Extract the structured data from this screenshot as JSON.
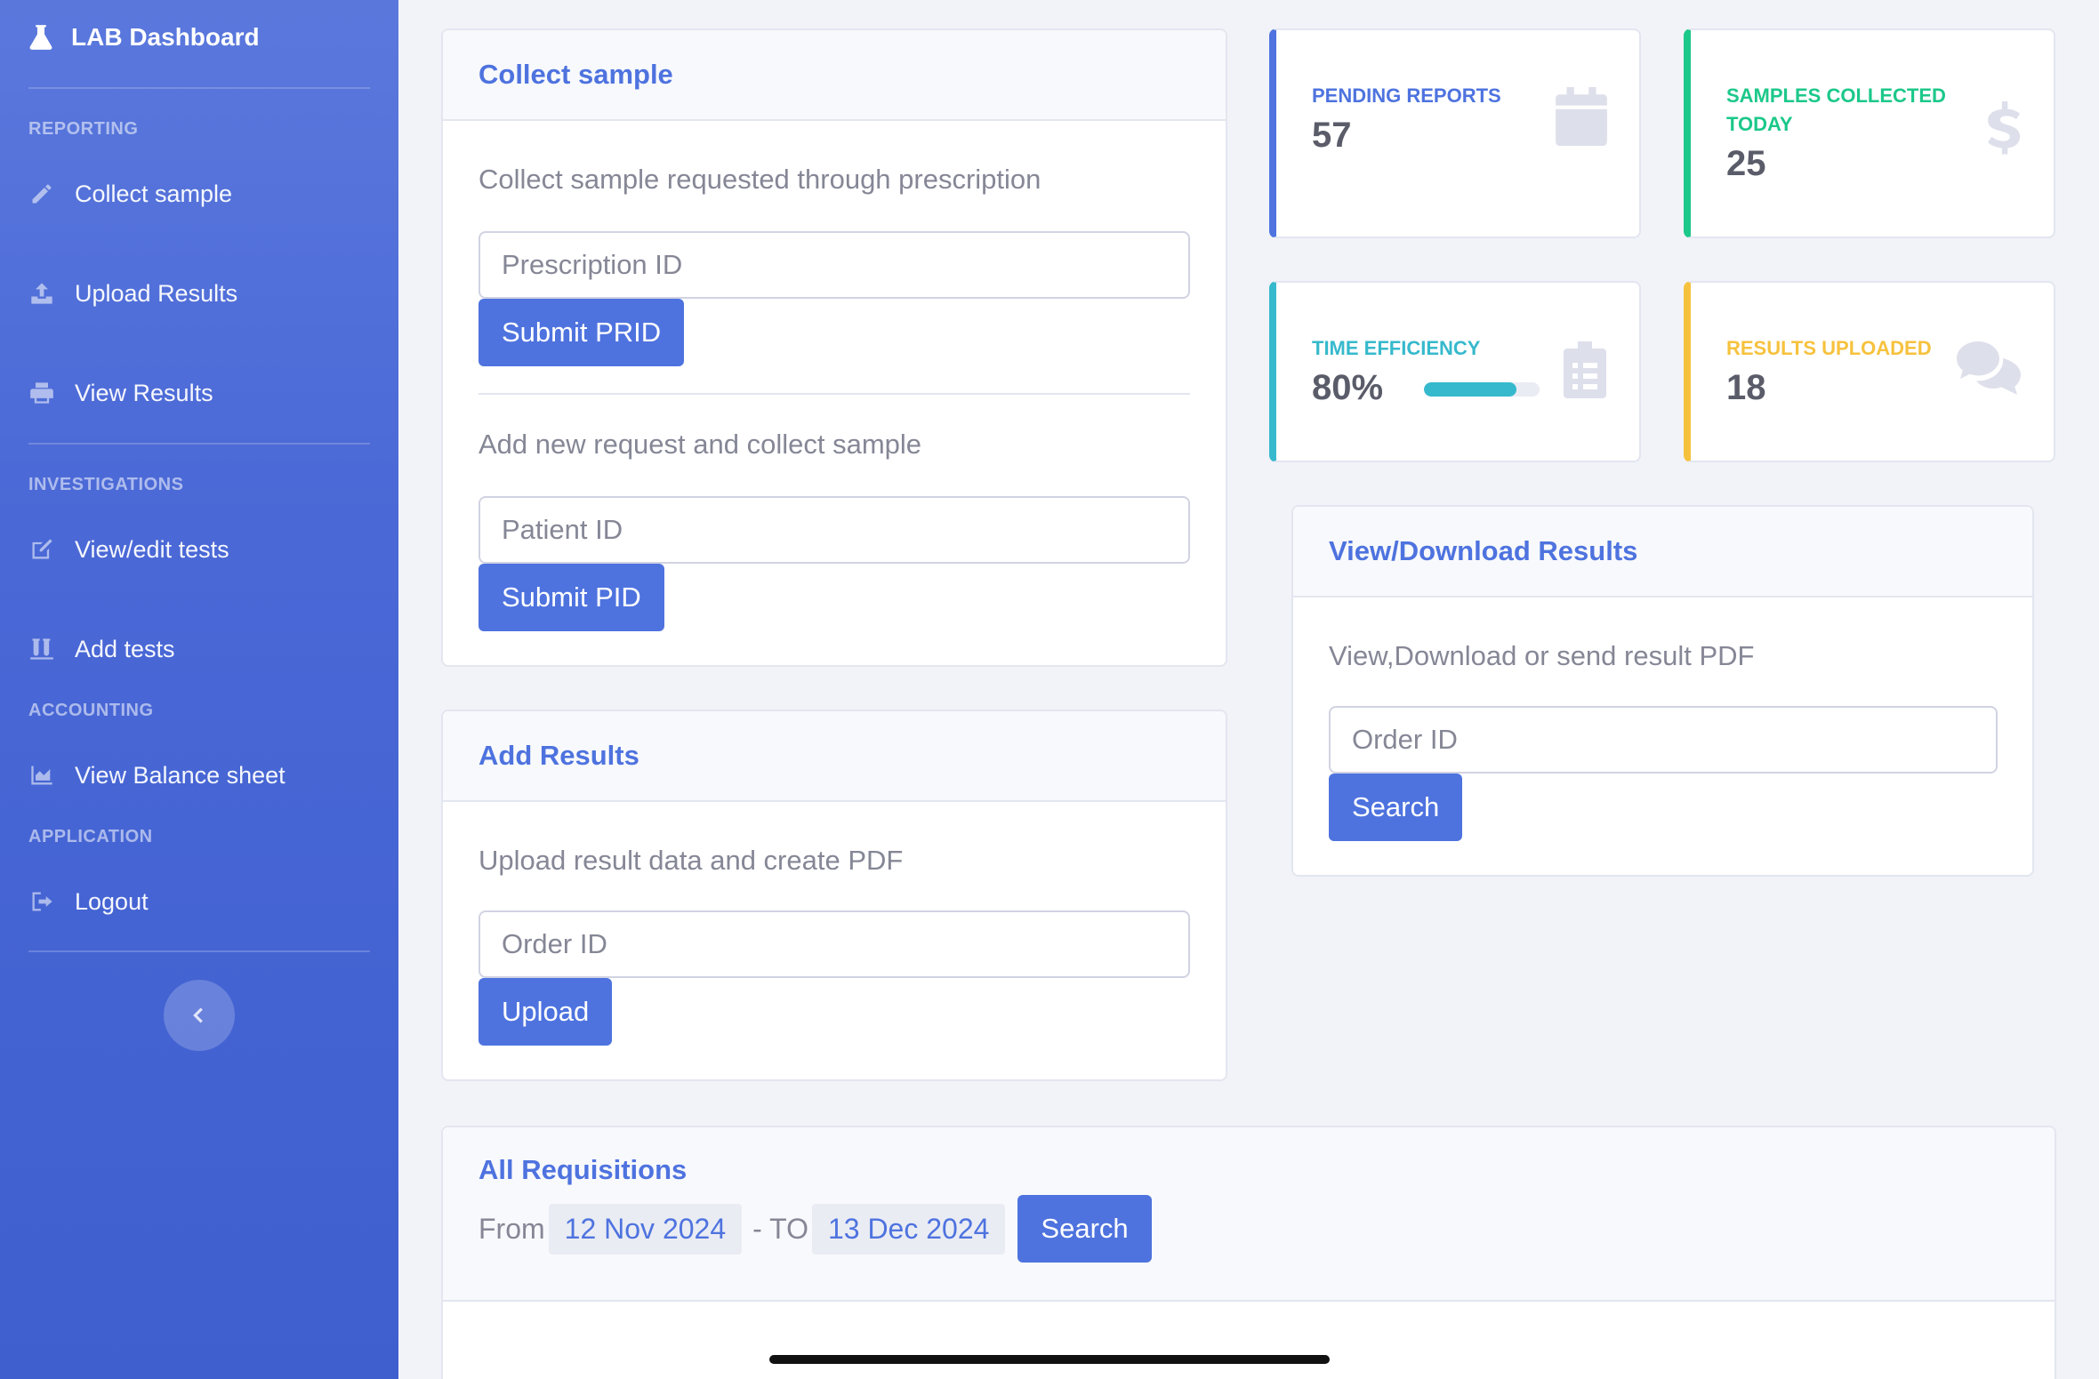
{
  "sidebar": {
    "brand": "LAB Dashboard",
    "sections": [
      {
        "heading": "REPORTING"
      },
      {
        "heading": "INVESTIGATIONS"
      },
      {
        "heading": "ACCOUNTING"
      },
      {
        "heading": "APPLICATION"
      }
    ],
    "items": [
      {
        "label": "Collect sample",
        "icon": "pen-icon"
      },
      {
        "label": "Upload Results",
        "icon": "upload-icon"
      },
      {
        "label": "View Results",
        "icon": "print-icon"
      },
      {
        "label": "View/edit tests",
        "icon": "edit-icon"
      },
      {
        "label": "Add tests",
        "icon": "vials-icon"
      },
      {
        "label": "View Balance sheet",
        "icon": "chart-area-icon"
      },
      {
        "label": "Logout",
        "icon": "sign-out-icon"
      }
    ]
  },
  "collect": {
    "title": "Collect sample",
    "text1": "Collect sample requested through prescription",
    "prescription_placeholder": "Prescription ID",
    "submit_prid": "Submit PRID",
    "text2": "Add new request and collect sample",
    "patient_placeholder": "Patient ID",
    "submit_pid": "Submit PID"
  },
  "add_results": {
    "title": "Add Results",
    "text": "Upload result data and create PDF",
    "order_placeholder": "Order ID",
    "upload": "Upload"
  },
  "stats": {
    "pending": {
      "label": "PENDING REPORTS",
      "value": "57",
      "color": "#4e73df",
      "icon": "calendar-icon"
    },
    "samples": {
      "label": "SAMPLES COLLECTED TODAY",
      "value": "25",
      "color": "#1cc88a",
      "icon": "dollar-icon"
    },
    "efficiency": {
      "label": "TIME EFFICIENCY",
      "value": "80%",
      "progress": 0.8,
      "color": "#36b9cc",
      "icon": "clipboard-list-icon"
    },
    "uploaded": {
      "label": "RESULTS UPLOADED",
      "value": "18",
      "color": "#f6c23e",
      "icon": "comments-icon"
    }
  },
  "view_download": {
    "title": "View/Download Results",
    "text": "View,Download or send result PDF",
    "order_placeholder": "Order ID",
    "search": "Search"
  },
  "requisitions": {
    "title": "All Requisitions",
    "from_label": "From",
    "from_date": "12 Nov 2024",
    "to_label": "- TO",
    "to_date": "13 Dec 2024",
    "search": "Search"
  }
}
